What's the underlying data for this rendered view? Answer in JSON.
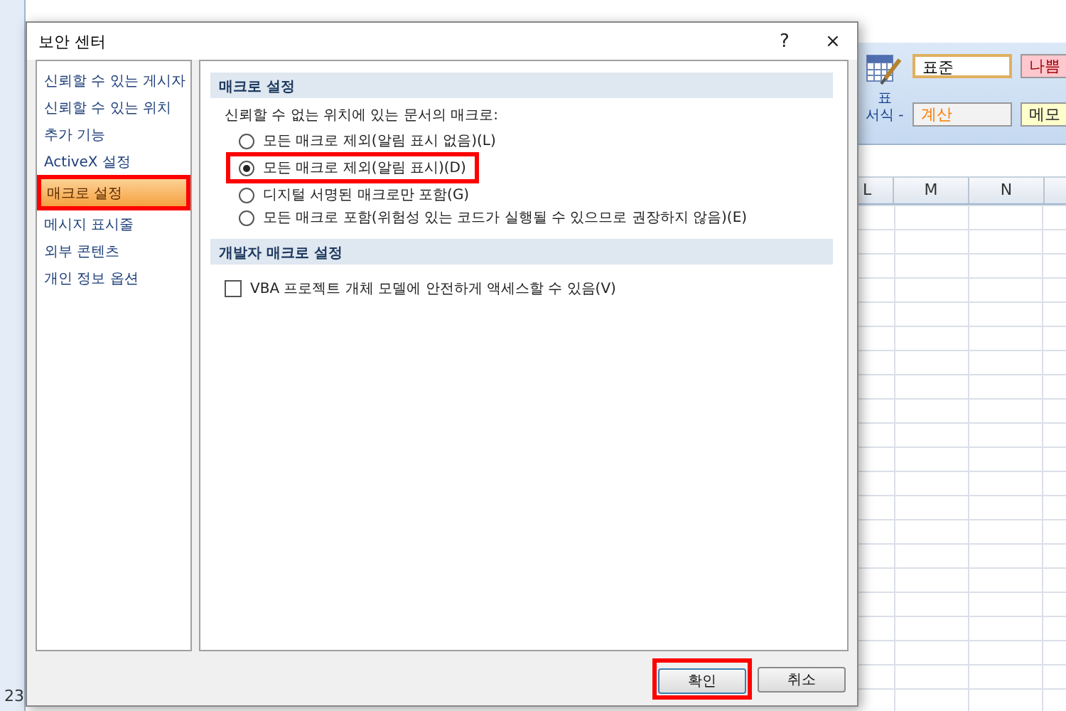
{
  "background": {
    "ribbon": {
      "table_format_button": {
        "lines": [
          "표",
          "서식 -"
        ]
      },
      "cell_styles": [
        {
          "label": "표준",
          "kind": "normal"
        },
        {
          "label": "나쁨",
          "kind": "bad"
        },
        {
          "label": "계산",
          "kind": "calc"
        },
        {
          "label": "메모",
          "kind": "memo"
        }
      ]
    },
    "columns": [
      "L",
      "M",
      "N"
    ],
    "row_numbers": [
      "23"
    ]
  },
  "dialog": {
    "title": "보안 센터",
    "help": "?",
    "close": "×",
    "nav": [
      {
        "label": "신뢰할 수 있는 게시자",
        "selected": false,
        "highlighted": false
      },
      {
        "label": "신뢰할 수 있는 위치",
        "selected": false,
        "highlighted": false
      },
      {
        "label": "추가 기능",
        "selected": false,
        "highlighted": false
      },
      {
        "label": "ActiveX 설정",
        "selected": false,
        "highlighted": false
      },
      {
        "label": "매크로 설정",
        "selected": true,
        "highlighted": true
      },
      {
        "label": "메시지 표시줄",
        "selected": false,
        "highlighted": false
      },
      {
        "label": "외부 콘텐츠",
        "selected": false,
        "highlighted": false
      },
      {
        "label": "개인 정보 옵션",
        "selected": false,
        "highlighted": false
      }
    ],
    "sections": [
      {
        "title": "매크로 설정",
        "prompt": "신뢰할 수 없는 위치에 있는 문서의 매크로:",
        "items": [
          {
            "kind": "radio",
            "label": "모든 매크로 제외(알림 표시 없음)(L)",
            "selected": false,
            "highlighted": false
          },
          {
            "kind": "radio",
            "label": "모든 매크로 제외(알림 표시)(D)",
            "selected": true,
            "highlighted": true
          },
          {
            "kind": "radio",
            "label": "디지털 서명된 매크로만 포함(G)",
            "selected": false,
            "highlighted": false
          },
          {
            "kind": "radio",
            "label": "모든 매크로 포함(위험성 있는 코드가 실행될 수 있으므로 권장하지 않음)(E)",
            "selected": false,
            "highlighted": false
          }
        ]
      },
      {
        "title": "개발자 매크로 설정",
        "items": [
          {
            "kind": "checkbox",
            "label": "VBA 프로젝트 개체 모델에 안전하게 액세스할 수 있음(V)",
            "checked": false,
            "highlighted": false
          }
        ]
      }
    ],
    "buttons": [
      {
        "label": "확인",
        "default": true,
        "highlighted": true
      },
      {
        "label": "취소",
        "default": false,
        "highlighted": false
      }
    ]
  }
}
